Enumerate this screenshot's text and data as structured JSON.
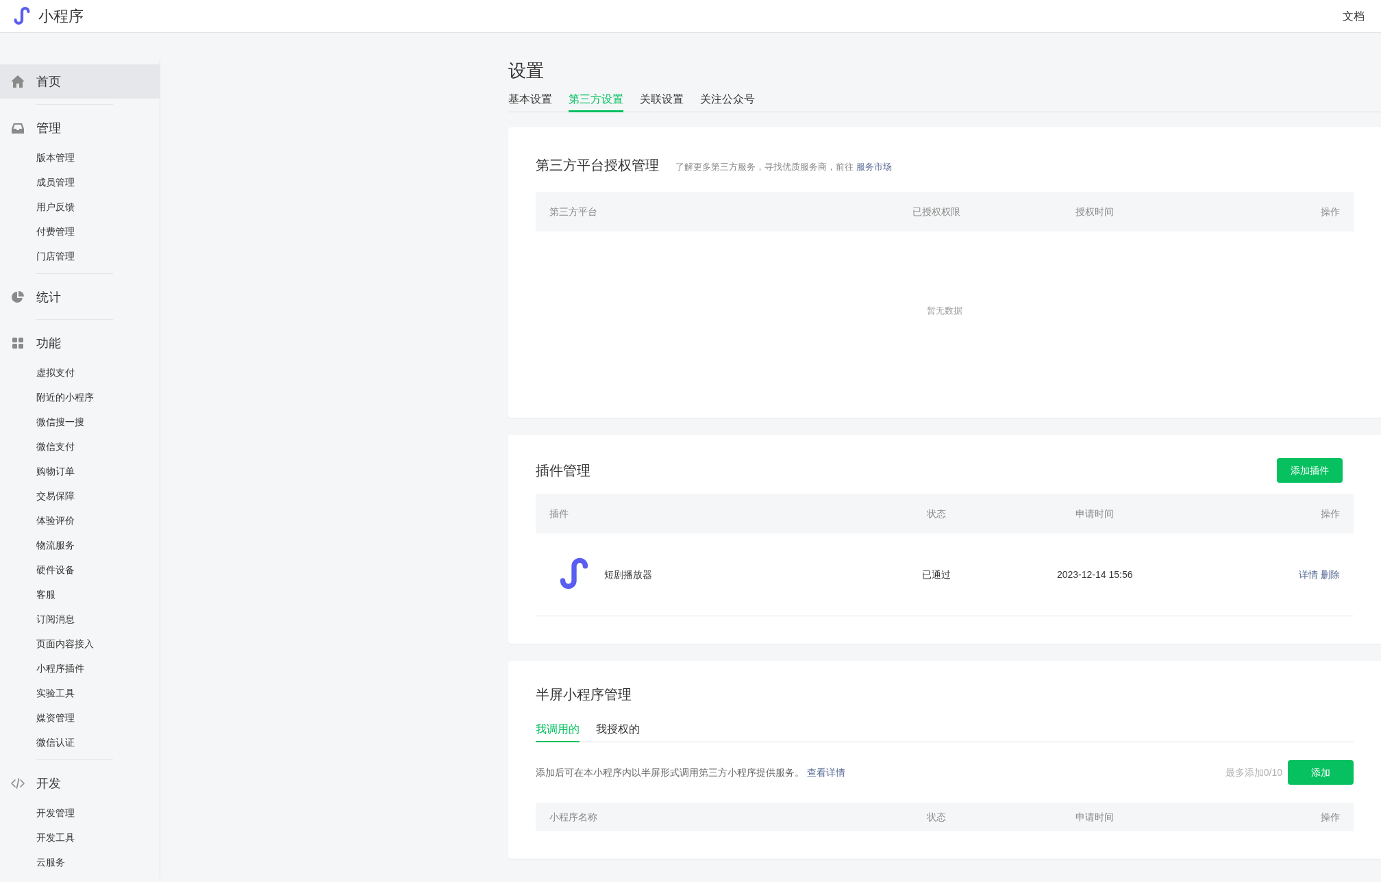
{
  "header": {
    "logo_text": "小程序",
    "docs_link": "文档"
  },
  "sidebar": [
    {
      "kind": "home",
      "label": "首页",
      "selected": true
    },
    {
      "kind": "inbox",
      "label": "管理",
      "selected": false,
      "children": [
        "版本管理",
        "成员管理",
        "用户反馈",
        "付费管理",
        "门店管理"
      ]
    },
    {
      "kind": "pie",
      "label": "统计",
      "selected": false
    },
    {
      "kind": "grid",
      "label": "功能",
      "selected": false,
      "children": [
        "虚拟支付",
        "附近的小程序",
        "微信搜一搜",
        "微信支付",
        "购物订单",
        "交易保障",
        "体验评价",
        "物流服务",
        "硬件设备",
        "客服",
        "订阅消息",
        "页面内容接入",
        "小程序插件",
        "实验工具",
        "媒资管理",
        "微信认证"
      ]
    },
    {
      "kind": "code",
      "label": "开发",
      "selected": false,
      "children": [
        "开发管理",
        "开发工具",
        "云服务"
      ]
    }
  ],
  "page_title": "设置",
  "tabs": [
    {
      "label": "基本设置",
      "selected": false
    },
    {
      "label": "第三方设置",
      "selected": true
    },
    {
      "label": "关联设置",
      "selected": false
    },
    {
      "label": "关注公众号",
      "selected": false
    }
  ],
  "third_party": {
    "title": "第三方平台授权管理",
    "hint": "了解更多第三方服务，寻找优质服务商，前往",
    "hint_link": "服务市场",
    "table": {
      "columns": [
        "第三方平台",
        "已授权权限",
        "授权时间",
        "操作"
      ],
      "empty_text": "暂无数据"
    }
  },
  "plugins": {
    "title": "插件管理",
    "add_button": "添加插件",
    "table": {
      "columns": [
        "插件",
        "状态",
        "申请时间",
        "操作"
      ],
      "rows": [
        {
          "name": "短剧播放器",
          "status": "已通过",
          "applied_time": "2023-12-14 15:56",
          "actions": [
            "详情",
            "删除"
          ]
        }
      ]
    }
  },
  "half_screen": {
    "title": "半屏小程序管理",
    "tabs": [
      {
        "label": "我调用的",
        "selected": true
      },
      {
        "label": "我授权的",
        "selected": false
      }
    ],
    "description": "添加后可在本小程序内以半屏形式调用第三方小程序提供服务。",
    "description_link": "查看详情",
    "limit": "最多添加0/10",
    "add_button": "添加",
    "table": {
      "columns": [
        "小程序名称",
        "状态",
        "申请时间",
        "操作"
      ]
    }
  }
}
